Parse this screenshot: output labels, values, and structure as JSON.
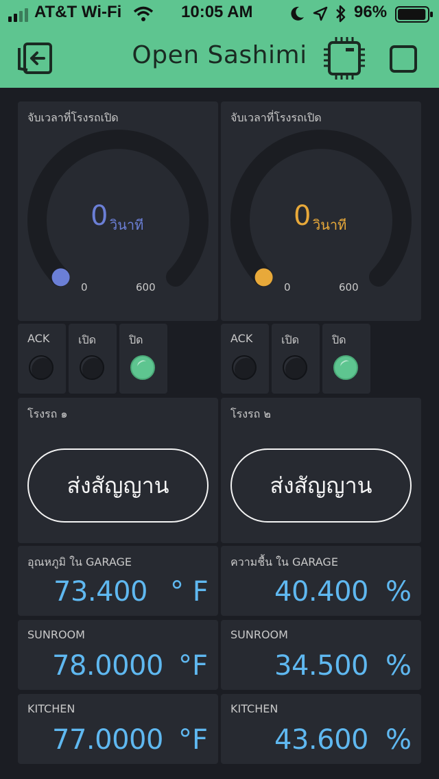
{
  "status": {
    "carrier": "AT&T Wi-Fi",
    "time": "10:05 AM",
    "battery": "96%",
    "battery_level": 0.96
  },
  "header": {
    "title": "Open Sashimi",
    "left_icon": "exit-icon",
    "right_icons": [
      "device-chip-icon",
      "square-icon"
    ]
  },
  "colors": {
    "header_bg": "#5ec590",
    "gauge1_accent": "#6b7fd6",
    "gauge2_accent": "#e8a93a",
    "led_on": "#5ec590",
    "value_text": "#5fb8f0"
  },
  "gauges": [
    {
      "label": "จับเวลาที่โรงรถเปิด",
      "value": "0",
      "unit": "วินาที",
      "min": "0",
      "max": "600",
      "level": 0
    },
    {
      "label": "จับเวลาที่โรงรถเปิด",
      "value": "0",
      "unit": "วินาที",
      "min": "0",
      "max": "600",
      "level": 0
    }
  ],
  "leds": [
    {
      "label": "ACK",
      "on": false
    },
    {
      "label": "เปิด",
      "on": false
    },
    {
      "label": "ปิด",
      "on": true
    },
    {
      "label": "ACK",
      "on": false
    },
    {
      "label": "เปิด",
      "on": false
    },
    {
      "label": "ปิด",
      "on": true
    }
  ],
  "buttons": [
    {
      "label": "โรงรถ ๑",
      "button": "ส่งสัญญาน"
    },
    {
      "label": "โรงรถ ๒",
      "button": "ส่งสัญญาน"
    }
  ],
  "readings": [
    {
      "label": "อุณหภูมิ ใน GARAGE",
      "value": "73.400",
      "unit": "° F"
    },
    {
      "label": "ความชื้น ใน GARAGE",
      "value": "40.400",
      "unit": "%"
    },
    {
      "label": "SUNROOM",
      "value": "78.0000",
      "unit": "°F"
    },
    {
      "label": "SUNROOM",
      "value": "34.500",
      "unit": "%"
    },
    {
      "label": "KITCHEN",
      "value": "77.0000",
      "unit": "°F"
    },
    {
      "label": "KITCHEN",
      "value": "43.600",
      "unit": "%"
    }
  ]
}
